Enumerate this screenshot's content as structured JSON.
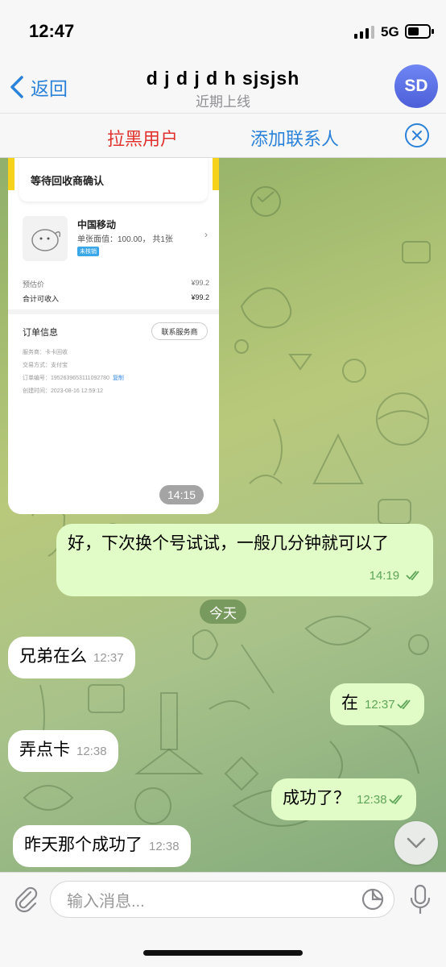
{
  "status_bar": {
    "time": "12:47",
    "network": "5G",
    "battery_level": 0.55
  },
  "header": {
    "back_label": "返回",
    "title": "d j d j d h sjsjsh",
    "subtitle": "近期上线",
    "avatar_initials": "SD"
  },
  "action_bar": {
    "block_label": "拉黑用户",
    "add_contact_label": "添加联系人"
  },
  "image_message": {
    "status_text": "等待回收商确认",
    "product_name": "中国移动",
    "product_detail": "单张面值：100.00，  共1张",
    "product_tag": "未核销",
    "estimated_price_label": "预估价",
    "estimated_price_value": "¥99.2",
    "total_label": "合计可收入",
    "total_value": "¥99.2",
    "order_info_title": "订单信息",
    "contact_merchant_label": "联系服务商",
    "order_rows": [
      {
        "label": "服务商：",
        "value": "卡卡回收"
      },
      {
        "label": "交易方式：",
        "value": "支付宝"
      },
      {
        "label": "订单编号：",
        "value": "19526396531110927​80",
        "copy": "复制"
      },
      {
        "label": "创建时间：",
        "value": "2023-08-16 12:59:12"
      }
    ],
    "time": "14:15"
  },
  "messages": [
    {
      "dir": "out",
      "text": "好，下次换个号试试，一般几分钟就可以了",
      "time": "14:19"
    },
    {
      "dir": "in",
      "text": "兄弟在么",
      "time": "12:37"
    },
    {
      "dir": "out",
      "text": "在",
      "time": "12:37"
    },
    {
      "dir": "in",
      "text": "弄点卡",
      "time": "12:38"
    },
    {
      "dir": "out",
      "text": "成功了？",
      "time": "12:38"
    },
    {
      "dir": "in",
      "text": "昨天那个成功了",
      "time": "12:38"
    }
  ],
  "date_chip": "今天",
  "input": {
    "placeholder": "输入消息..."
  },
  "icons": {
    "back": "chevron-left-icon",
    "close": "close-circle-icon",
    "scroll": "chevron-down-icon",
    "attach": "paperclip-icon",
    "sticker": "sticker-icon",
    "mic": "microphone-icon"
  },
  "colors": {
    "accent": "#2a82d9",
    "danger": "#e0322d",
    "outgoing_bubble": "#e1fcc6",
    "read_check": "#5fa55a"
  }
}
